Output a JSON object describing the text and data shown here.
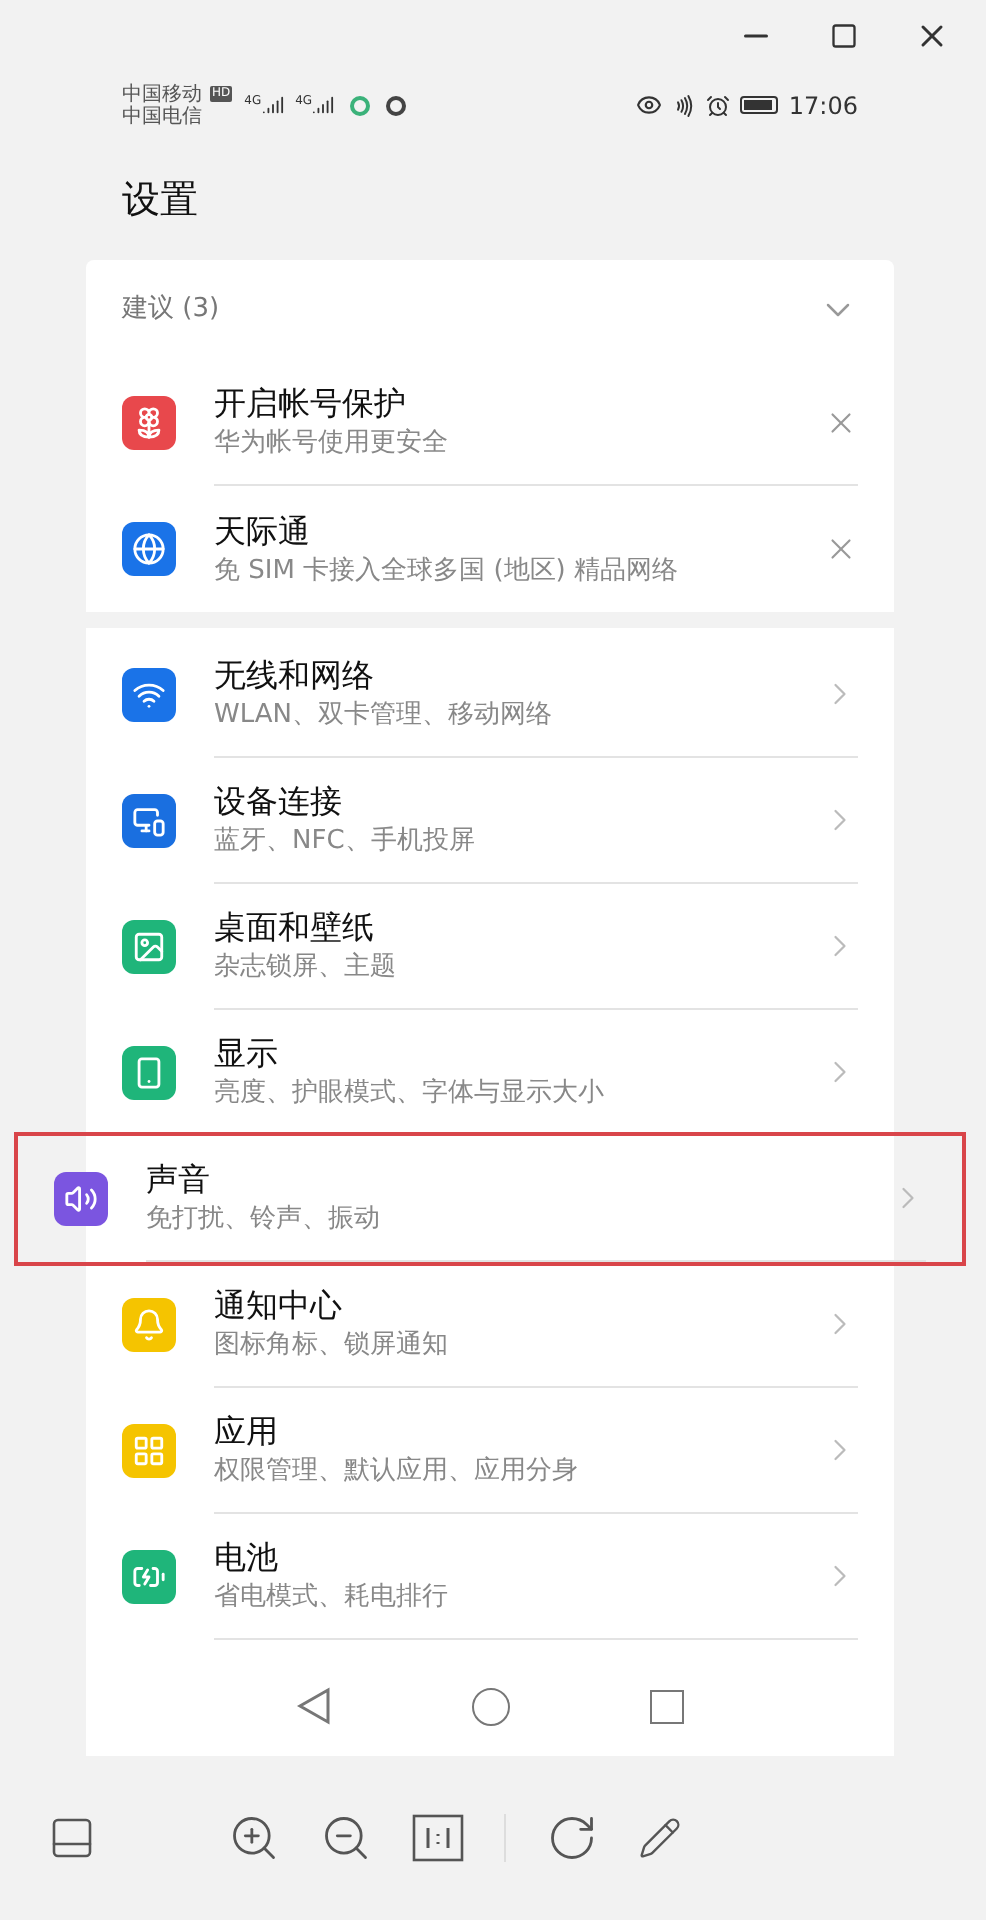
{
  "status_bar": {
    "carriers": [
      "中国移动",
      "中国电信"
    ],
    "hd_badge": "HD",
    "networks": [
      "4G",
      "4G"
    ],
    "time": "17:06"
  },
  "page_title": "设置",
  "suggestions": {
    "title": "建议 (3)",
    "expanded": true,
    "items": [
      {
        "kind": "huawei",
        "color": "#e8484c",
        "title": "开启帐号保护",
        "subtitle": "华为帐号使用更安全"
      },
      {
        "kind": "globe",
        "color": "#1a73e8",
        "title": "天际通",
        "subtitle": "免 SIM 卡接入全球多国 (地区) 精品网络"
      }
    ]
  },
  "settings": [
    {
      "kind": "wifi",
      "color": "#1a73e8",
      "title": "无线和网络",
      "subtitle": "WLAN、双卡管理、移动网络",
      "highlighted": false
    },
    {
      "kind": "devices",
      "color": "#1a6fe0",
      "title": "设备连接",
      "subtitle": "蓝牙、NFC、手机投屏",
      "highlighted": false
    },
    {
      "kind": "wallpaper",
      "color": "#1fb57a",
      "title": "桌面和壁纸",
      "subtitle": "杂志锁屏、主题",
      "highlighted": false
    },
    {
      "kind": "display",
      "color": "#1fb57a",
      "title": "显示",
      "subtitle": "亮度、护眼模式、字体与显示大小",
      "highlighted": false
    },
    {
      "kind": "sound",
      "color": "#7b55e0",
      "title": "声音",
      "subtitle": "免打扰、铃声、振动",
      "highlighted": true
    },
    {
      "kind": "bell",
      "color": "#f5c400",
      "title": "通知中心",
      "subtitle": "图标角标、锁屏通知",
      "highlighted": false
    },
    {
      "kind": "apps",
      "color": "#f5c400",
      "title": "应用",
      "subtitle": "权限管理、默认应用、应用分身",
      "highlighted": false
    },
    {
      "kind": "battery",
      "color": "#1fb57a",
      "title": "电池",
      "subtitle": "省电模式、耗电排行",
      "highlighted": false
    }
  ]
}
